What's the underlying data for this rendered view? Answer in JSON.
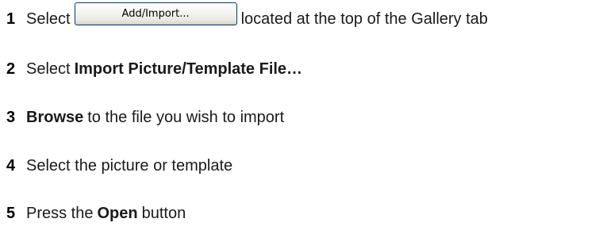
{
  "steps": [
    {
      "number": "1",
      "before": "Select",
      "button_label": "Add/Import...",
      "after": "located at the top of the Gallery tab"
    },
    {
      "number": "2",
      "before": "Select",
      "bold": "Import Picture/Template File…"
    },
    {
      "number": "3",
      "bold": "Browse",
      "after": "to the file you wish to import"
    },
    {
      "number": "4",
      "text": "Select the picture or template"
    },
    {
      "number": "5",
      "before": "Press the",
      "bold": "Open",
      "after": "button"
    }
  ]
}
